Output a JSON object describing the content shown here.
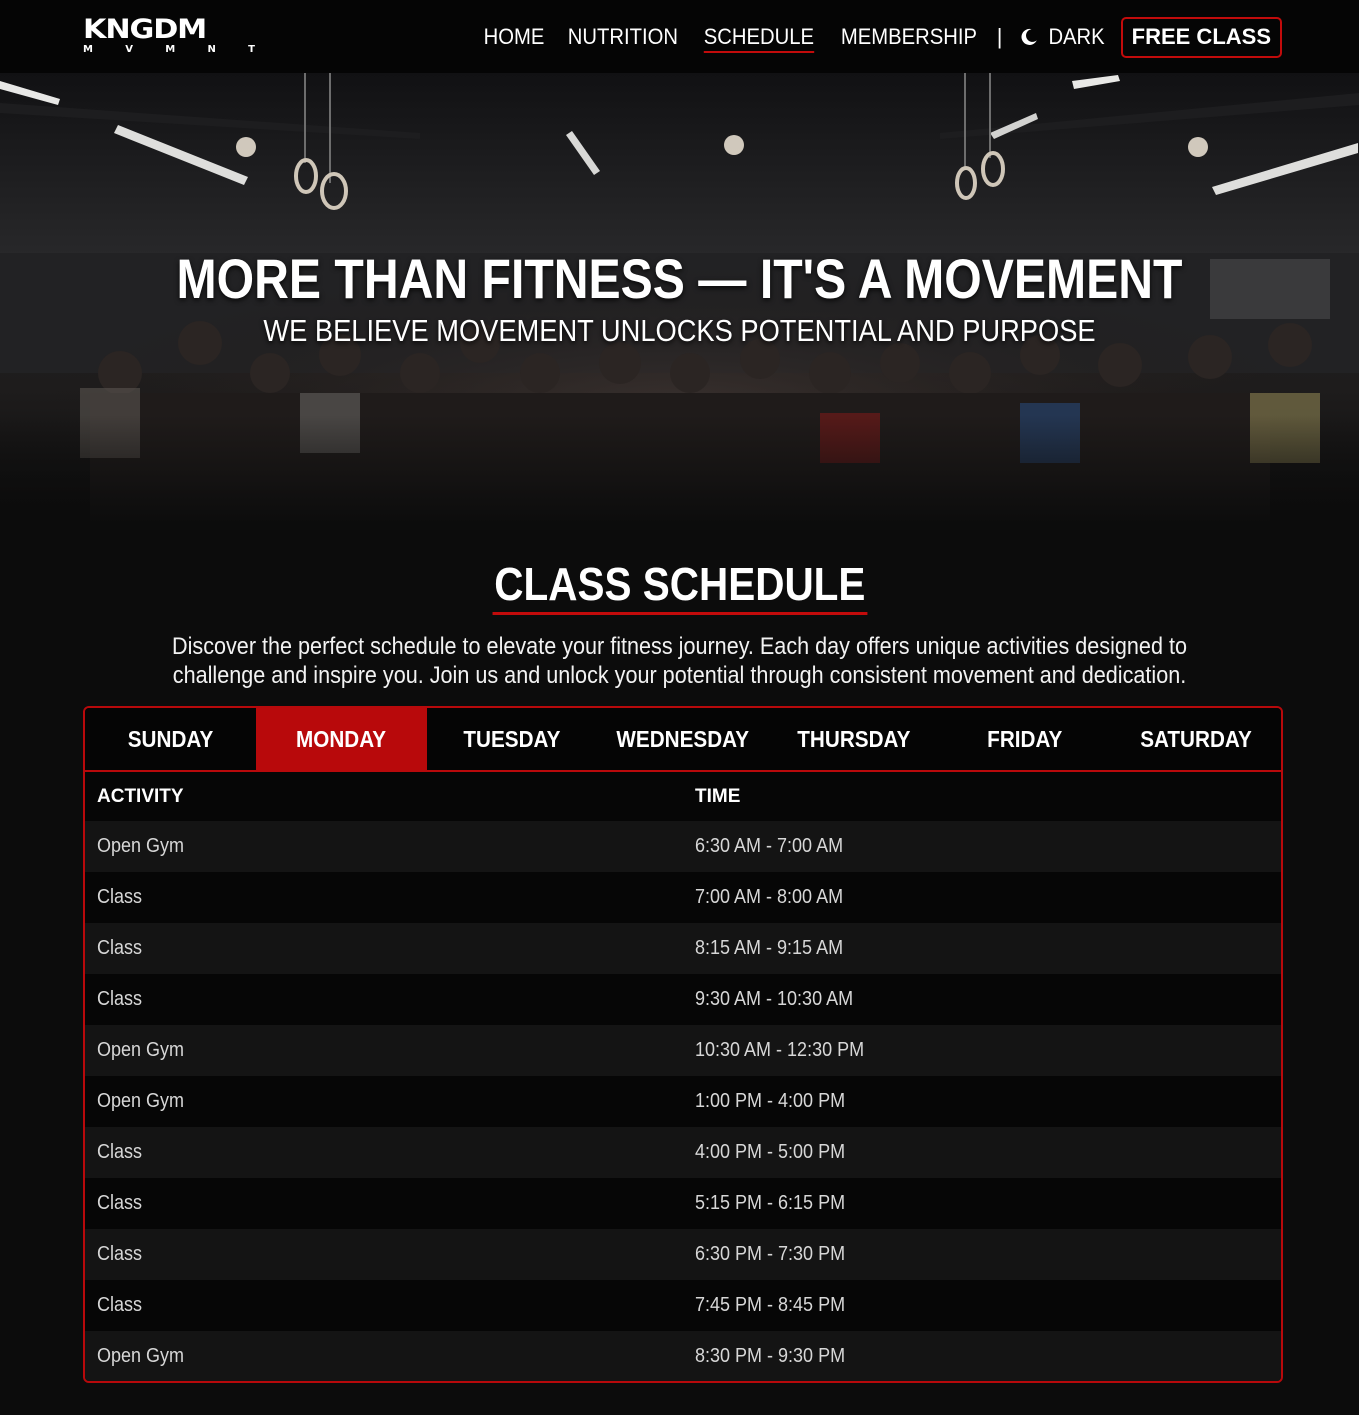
{
  "brand": {
    "logo_main": "KNGDM",
    "logo_sub": [
      "M",
      "V",
      "M",
      "N",
      "T"
    ]
  },
  "nav": {
    "links": [
      {
        "label": "HOME",
        "active": false
      },
      {
        "label": "NUTRITION",
        "active": false
      },
      {
        "label": "SCHEDULE",
        "active": true
      },
      {
        "label": "MEMBERSHIP",
        "active": false
      }
    ],
    "separator": "|",
    "theme_toggle": {
      "icon": "moon-icon",
      "label": "DARK"
    },
    "cta_label": "FREE CLASS"
  },
  "hero": {
    "title": "MORE THAN FITNESS — IT'S A MOVEMENT",
    "subtitle": "WE BELIEVE MOVEMENT UNLOCKS POTENTIAL AND PURPOSE"
  },
  "schedule": {
    "title": "CLASS SCHEDULE",
    "description": "Discover the perfect schedule to elevate your fitness journey. Each day offers unique activities designed to challenge and inspire you. Join us and unlock your potential through consistent movement and dedication.",
    "days": [
      "SUNDAY",
      "MONDAY",
      "TUESDAY",
      "WEDNESDAY",
      "THURSDAY",
      "FRIDAY",
      "SATURDAY"
    ],
    "selected_day": "MONDAY",
    "columns": [
      "ACTIVITY",
      "TIME"
    ],
    "rows": [
      {
        "activity": "Open Gym",
        "time": "6:30 AM - 7:00 AM"
      },
      {
        "activity": "Class",
        "time": "7:00 AM - 8:00 AM"
      },
      {
        "activity": "Class",
        "time": "8:15 AM - 9:15 AM"
      },
      {
        "activity": "Class",
        "time": "9:30 AM - 10:30 AM"
      },
      {
        "activity": "Open Gym",
        "time": "10:30 AM - 12:30 PM"
      },
      {
        "activity": "Open Gym",
        "time": "1:00 PM - 4:00 PM"
      },
      {
        "activity": "Class",
        "time": "4:00 PM - 5:00 PM"
      },
      {
        "activity": "Class",
        "time": "5:15 PM - 6:15 PM"
      },
      {
        "activity": "Class",
        "time": "6:30 PM - 7:30 PM"
      },
      {
        "activity": "Class",
        "time": "7:45 PM - 8:45 PM"
      },
      {
        "activity": "Open Gym",
        "time": "8:30 PM - 9:30 PM"
      }
    ]
  },
  "colors": {
    "accent": "#b8090b",
    "background": "#0c0c0c",
    "nav_background": "#050505",
    "row_light": "#141414",
    "row_dark": "#060606"
  }
}
